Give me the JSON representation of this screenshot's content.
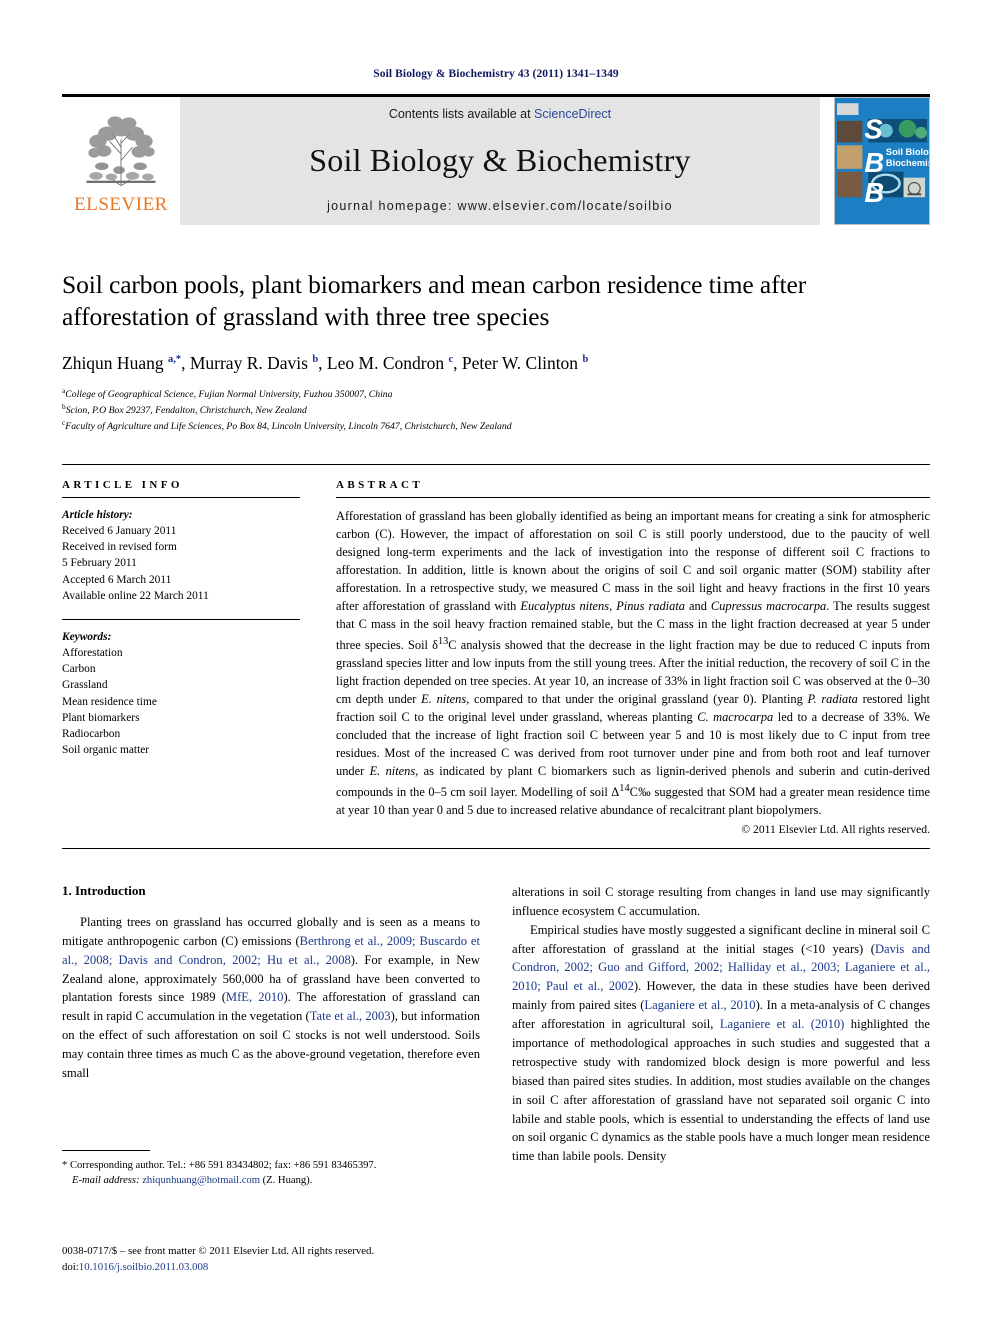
{
  "running_head": "Soil Biology & Biochemistry 43 (2011) 1341–1349",
  "masthead": {
    "publisher_name": "ELSEVIER",
    "contents_prefix": "Contents lists available at ",
    "sciencedirect": "ScienceDirect",
    "journal_title": "Soil Biology & Biochemistry",
    "homepage": "journal homepage: www.elsevier.com/locate/soilbio",
    "cover_letters": [
      "S",
      "B",
      "B"
    ],
    "cover_title_line1": "Soil Biology &",
    "cover_title_line2": "Biochemistry",
    "band_color": "#e4e4e4",
    "cover_color": "#1c7fc4",
    "elsevier_orange": "#E87722",
    "link_color": "#2b4a9b"
  },
  "article": {
    "title": "Soil carbon pools, plant biomarkers and mean carbon residence time after afforestation of grassland with three tree species",
    "authors_html": "Zhiqun Huang <sup>a,*</sup>, Murray R. Davis <sup>b</sup>, Leo M. Condron <sup>c</sup>, Peter W. Clinton <sup>b</sup>",
    "affiliations": [
      {
        "mark": "a",
        "text": "College of Geographical Science, Fujian Normal University, Fuzhou 350007, China"
      },
      {
        "mark": "b",
        "text": "Scion, P.O Box 29237, Fendalton, Christchurch, New Zealand"
      },
      {
        "mark": "c",
        "text": "Faculty of Agriculture and Life Sciences, Po Box 84, Lincoln University, Lincoln 7647, Christchurch, New Zealand"
      }
    ]
  },
  "article_info": {
    "heading": "ARTICLE INFO",
    "history_label": "Article history:",
    "history": [
      "Received 6 January 2011",
      "Received in revised form",
      "5 February 2011",
      "Accepted 6 March 2011",
      "Available online 22 March 2011"
    ],
    "keywords_label": "Keywords:",
    "keywords": [
      "Afforestation",
      "Carbon",
      "Grassland",
      "Mean residence time",
      "Plant biomarkers",
      "Radiocarbon",
      "Soil organic matter"
    ]
  },
  "abstract": {
    "heading": "ABSTRACT",
    "text_html": "Afforestation of grassland has been globally identified as being an important means for creating a sink for atmospheric carbon (C). However, the impact of afforestation on soil C is still poorly understood, due to the paucity of well designed long-term experiments and the lack of investigation into the response of different soil C fractions to afforestation. In addition, little is known about the origins of soil C and soil organic matter (SOM) stability after afforestation. In a retrospective study, we measured C mass in the soil light and heavy fractions in the first 10 years after afforestation of grassland with <i>Eucalyptus nitens</i>, <i>Pinus radiata</i> and <i>Cupressus macrocarpa</i>. The results suggest that C mass in the soil heavy fraction remained stable, but the C mass in the light fraction decreased at year 5 under three species. Soil &#948;<sup>13</sup>C analysis showed that the decrease in the light fraction may be due to reduced C inputs from grassland species litter and low inputs from the still young trees. After the initial reduction, the recovery of soil C in the light fraction depended on tree species. At year 10, an increase of 33% in light fraction soil C was observed at the 0&#8211;30 cm depth under <i>E. nitens</i>, compared to that under the original grassland (year 0). Planting <i>P. radiata</i> restored light fraction soil C to the original level under grassland, whereas planting <i>C. macrocarpa</i> led to a decrease of 33%. We concluded that the increase of light fraction soil C between year 5 and 10 is most likely due to C input from tree residues. Most of the increased C was derived from root turnover under pine and from both root and leaf turnover under <i>E. nitens</i>, as indicated by plant C biomarkers such as lignin-derived phenols and suberin and cutin-derived compounds in the 0&#8211;5 cm soil layer. Modelling of soil &#916;<sup>14</sup>C&#8240; suggested that SOM had a greater mean residence time at year 10 than year 0 and 5 due to increased relative abundance of recalcitrant plant biopolymers.",
    "copyright": "© 2011 Elsevier Ltd. All rights reserved."
  },
  "body": {
    "section_number_title": "1. Introduction",
    "left_paragraphs_html": [
      "Planting trees on grassland has occurred globally and is seen as a means to mitigate anthropogenic carbon (C) emissions (<span class=\"cite\">Berthrong et al., 2009; Buscardo et al., 2008; Davis and Condron, 2002; Hu et al., 2008</span>). For example, in New Zealand alone, approximately 560,000 ha of grassland have been converted to plantation forests since 1989 (<span class=\"cite\">MfE, 2010</span>). The afforestation of grassland can result in rapid C accumulation in the vegetation (<span class=\"cite\">Tate et al., 2003</span>), but information on the effect of such afforestation on soil C stocks is not well understood. Soils may contain three times as much C as the above-ground vegetation, therefore even small"
    ],
    "right_paragraphs_html": [
      "alterations in soil C storage resulting from changes in land use may significantly influence ecosystem C accumulation.",
      "Empirical studies have mostly suggested a significant decline in mineral soil C after afforestation of grassland at the initial stages (&lt;10 years) (<span class=\"cite\">Davis and Condron, 2002; Guo and Gifford, 2002; Halliday et al., 2003; Laganiere et al., 2010; Paul et al., 2002</span>). However, the data in these studies have been derived mainly from paired sites (<span class=\"cite\">Laganiere et al., 2010</span>). In a meta-analysis of C changes after afforestation in agricultural soil, <span class=\"cite\">Laganiere et al. (2010)</span> highlighted the importance of methodological approaches in such studies and suggested that a retrospective study with randomized block design is more powerful and less biased than paired sites studies. In addition, most studies available on the changes in soil C after afforestation of grassland have not separated soil organic C into labile and stable pools, which is essential to understanding the effects of land use on soil organic C dynamics as the stable pools have a much longer mean residence time than labile pools. Density"
    ]
  },
  "footnote": {
    "line1": "* Corresponding author. Tel.: +86 591 83434802; fax: +86 591 83465397.",
    "email_label": "E-mail address:",
    "email": "zhiqunhuang@hotmail.com",
    "email_suffix": "(Z. Huang)."
  },
  "page_footer": {
    "line1": "0038-0717/$ – see front matter © 2011 Elsevier Ltd. All rights reserved.",
    "doi_label": "doi:",
    "doi": "10.1016/j.soilbio.2011.03.008"
  }
}
